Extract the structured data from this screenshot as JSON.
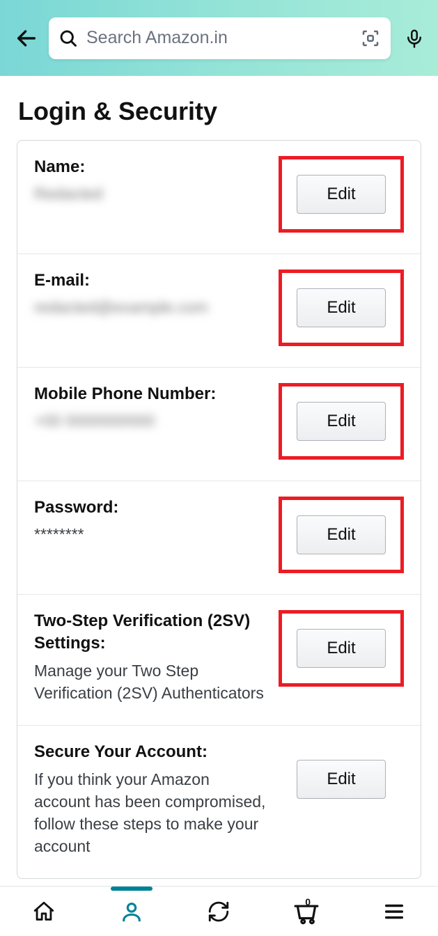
{
  "header": {
    "search_placeholder": "Search Amazon.in"
  },
  "title": "Login & Security",
  "rows": [
    {
      "label": "Name:",
      "value": "Redacted",
      "blur": true,
      "highlight": true,
      "edit": "Edit"
    },
    {
      "label": "E-mail:",
      "value": "redacted@example.com",
      "blur": true,
      "highlight": true,
      "edit": "Edit"
    },
    {
      "label": "Mobile Phone Number:",
      "value": "+00 0000000000",
      "blur": true,
      "highlight": true,
      "edit": "Edit"
    },
    {
      "label": "Password:",
      "value": "********",
      "blur": false,
      "highlight": true,
      "edit": "Edit"
    },
    {
      "label": "Two-Step Verification (2SV) Settings:",
      "value": "Manage your Two Step Verification (2SV) Authenticators",
      "blur": false,
      "highlight": true,
      "edit": "Edit"
    },
    {
      "label": "Secure Your Account:",
      "value": "If you think your Amazon account has been compromised, follow these steps to make your account",
      "blur": false,
      "highlight": false,
      "edit": "Edit"
    }
  ],
  "nav": {
    "cart_count": "0"
  }
}
